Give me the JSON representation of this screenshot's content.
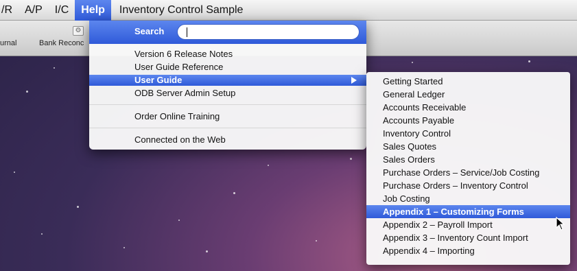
{
  "menubar": {
    "items": [
      "/R",
      "A/P",
      "I/C",
      "Help"
    ],
    "app_title": "Inventory Control Sample"
  },
  "toolbar": {
    "labels": [
      "urnal",
      "Bank Reconc"
    ],
    "icon": "gear-icon"
  },
  "help_menu": {
    "search_label": "Search",
    "search_value": "",
    "group1": [
      "Version 6 Release Notes",
      "User Guide Reference",
      "User Guide",
      "ODB Server Admin Setup"
    ],
    "selected_item": "User Guide",
    "group2": [
      "Order Online Training"
    ],
    "group3": [
      "Connected on the Web"
    ]
  },
  "user_guide_submenu": {
    "items": [
      "Getting Started",
      "General Ledger",
      "Accounts Receivable",
      "Accounts Payable",
      "Inventory Control",
      "Sales Quotes",
      "Sales Orders",
      "Purchase Orders – Service/Job Costing",
      "Purchase Orders – Inventory Control",
      "Job Costing",
      "Appendix 1 – Customizing Forms",
      "Appendix 2 – Payroll Import",
      "Appendix 3 – Inventory Count Import",
      "Appendix 4 – Importing"
    ],
    "selected_item": "Appendix 1 – Customizing Forms"
  },
  "colors": {
    "selection": "#3b66e0",
    "menu_bg": "#f8f8f8",
    "desktop": "#3a2c58"
  }
}
